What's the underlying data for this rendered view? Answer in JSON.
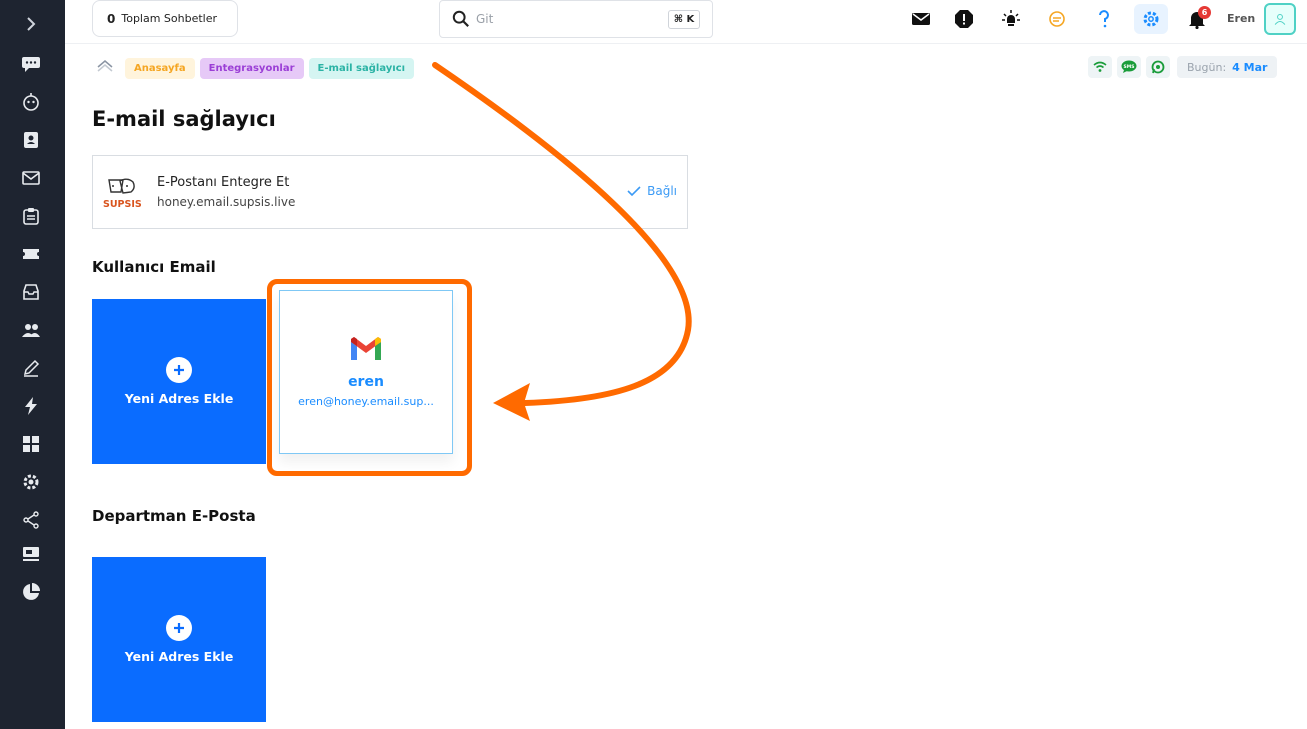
{
  "topbar": {
    "chats_count": "0",
    "chats_label": "Toplam Sohbetler",
    "search_placeholder": "Git",
    "search_shortcut": "⌘ K",
    "notification_count": "6",
    "user_name": "Eren"
  },
  "breadcrumb": [
    "Anasayfa",
    "Entegrasyonlar",
    "E-mail sağlayıcı"
  ],
  "status": {
    "sms_label": "SMS",
    "today_label": "Bugün:",
    "today_value": "4 Mar"
  },
  "page": {
    "title": "E-mail sağlayıcı"
  },
  "provider": {
    "logo_text": "SUPSIS",
    "name": "E-Postanı Entegre Et",
    "host": "honey.email.supsis.live",
    "status": "Bağlı"
  },
  "user_email": {
    "section_title": "Kullanıcı Email",
    "add_label": "Yeni Adres Ekle",
    "accounts": [
      {
        "name": "eren",
        "email": "eren@honey.email.sup...",
        "icon": "gmail-icon"
      }
    ]
  },
  "department_email": {
    "section_title": "Departman E-Posta",
    "add_label": "Yeni Adres Ekle"
  },
  "colors": {
    "sidebar": "#1e2430",
    "primary": "#0a6cff",
    "highlight": "#ff6a00",
    "link": "#1a8cff"
  }
}
